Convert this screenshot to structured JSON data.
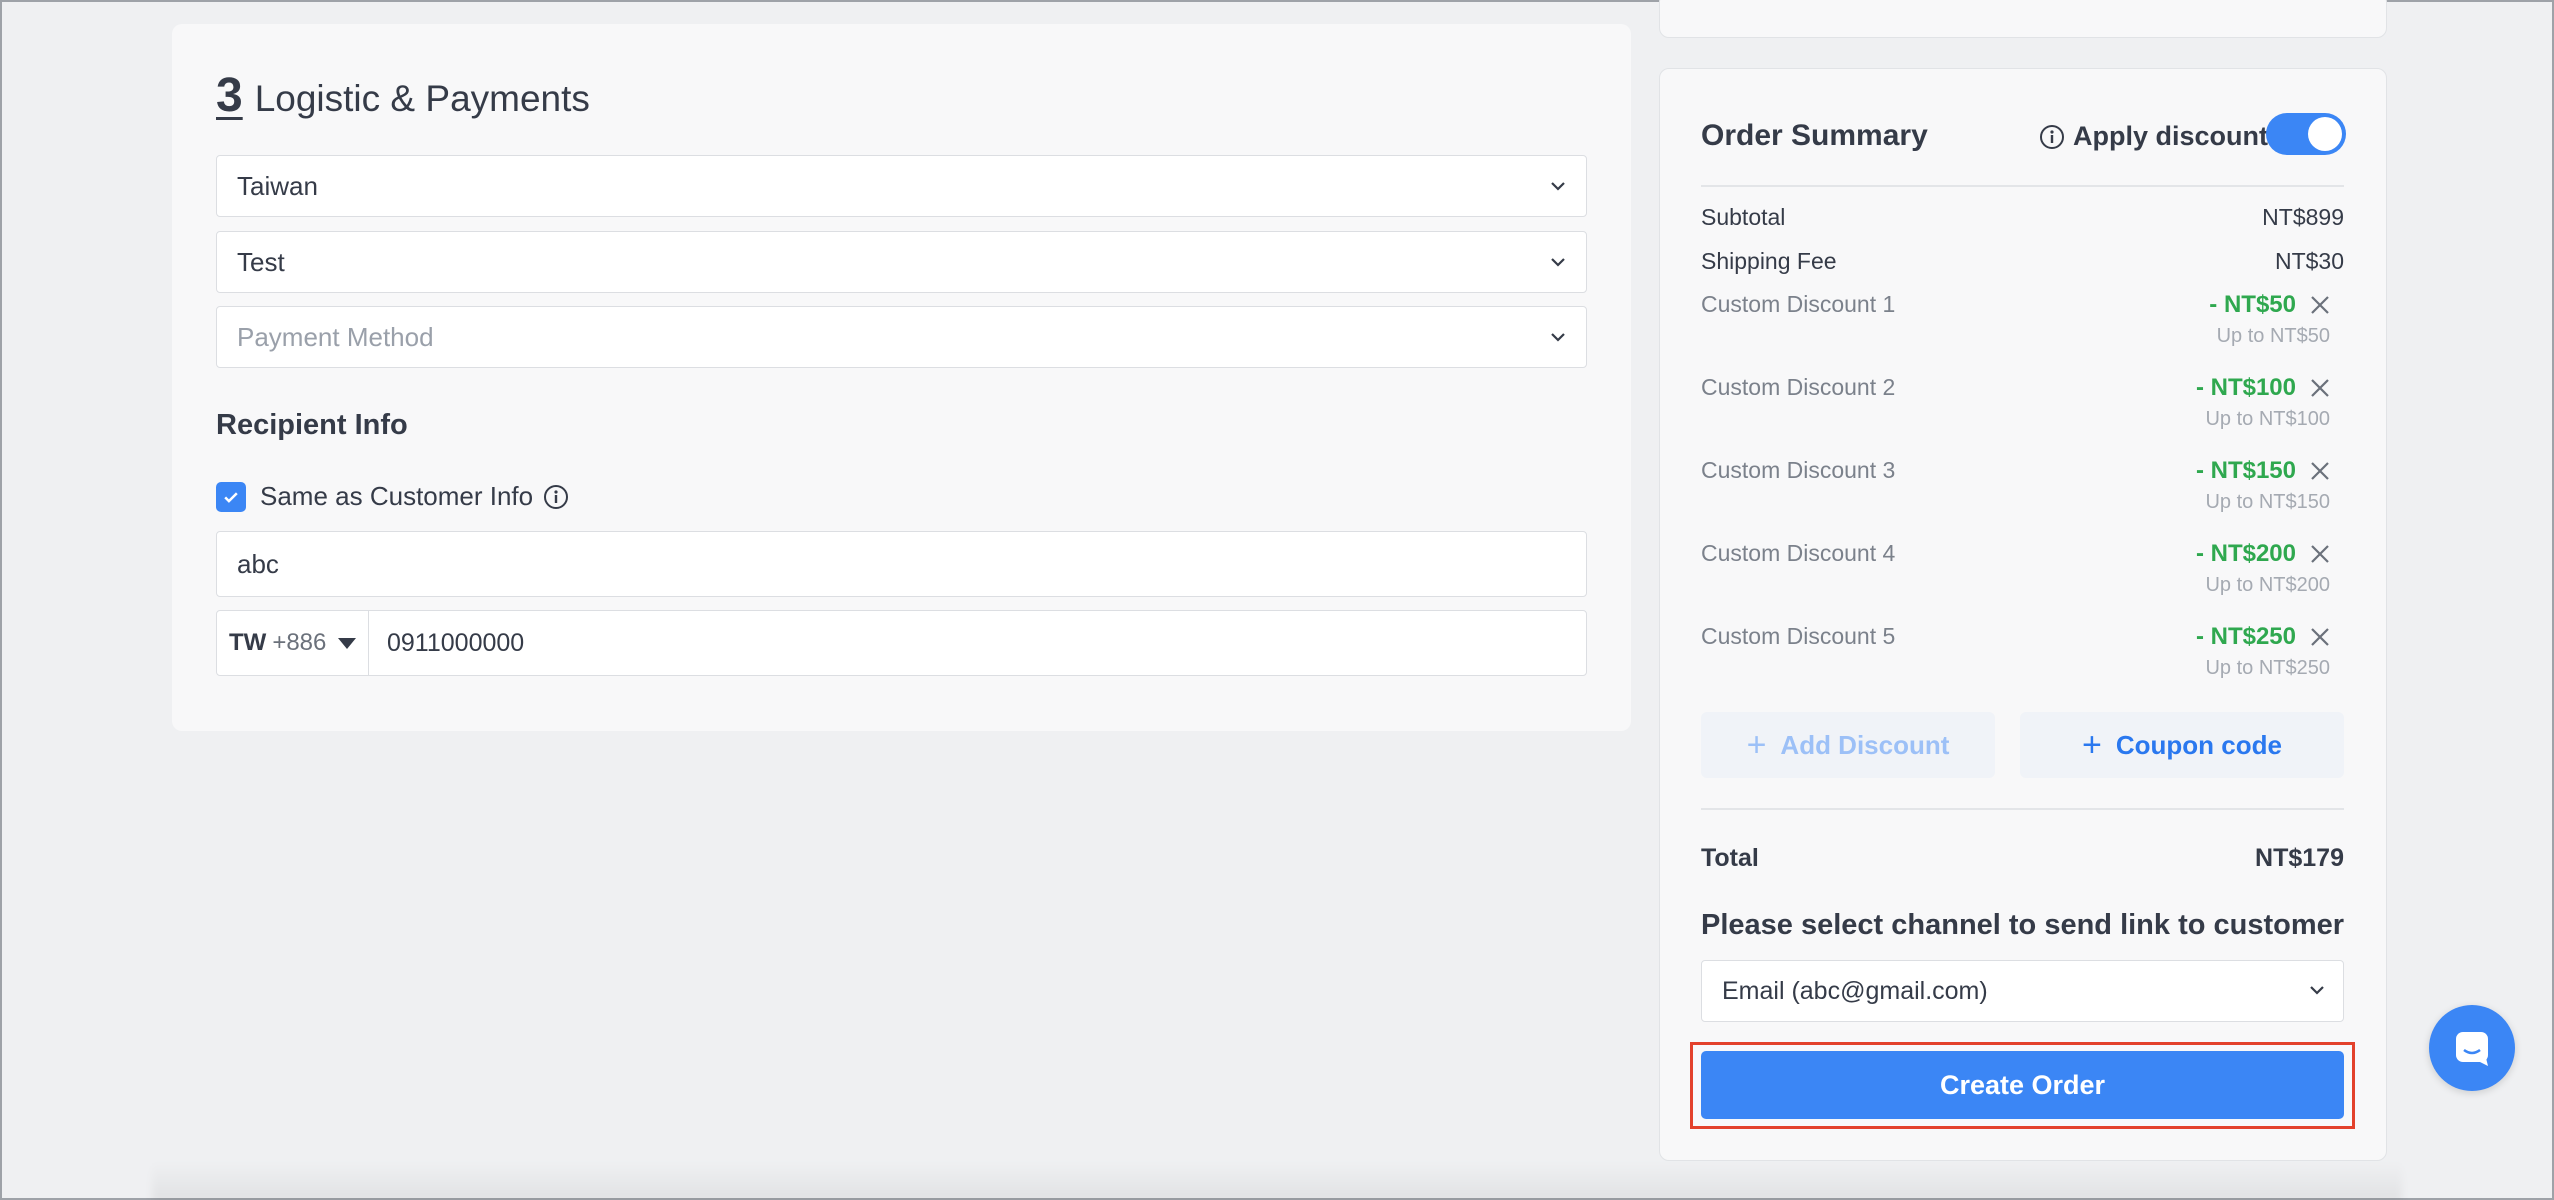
{
  "logistics": {
    "step_number": "3",
    "title": "Logistic & Payments",
    "country_select": "Taiwan",
    "delivery_select": "Test",
    "payment_placeholder": "Payment Method"
  },
  "recipient": {
    "title": "Recipient Info",
    "same_as_customer_label": "Same as Customer Info",
    "same_as_customer_checked": true,
    "name_value": "abc",
    "country_code": "TW",
    "dial_code": "+886",
    "phone_value": "0911000000"
  },
  "summary": {
    "title": "Order Summary",
    "apply_discount_label": "Apply discount",
    "apply_discount_on": true,
    "subtotal_label": "Subtotal",
    "subtotal_value": "NT$899",
    "shipping_label": "Shipping Fee",
    "shipping_value": "NT$30",
    "discounts": [
      {
        "label": "Custom Discount 1",
        "amount": "- NT$50",
        "upto": "Up to  NT$50"
      },
      {
        "label": "Custom Discount 2",
        "amount": "- NT$100",
        "upto": "Up to  NT$100"
      },
      {
        "label": "Custom Discount 3",
        "amount": "- NT$150",
        "upto": "Up to  NT$150"
      },
      {
        "label": "Custom Discount 4",
        "amount": "- NT$200",
        "upto": "Up to  NT$200"
      },
      {
        "label": "Custom Discount 5",
        "amount": "- NT$250",
        "upto": "Up to  NT$250"
      }
    ],
    "add_discount_label": "Add Discount",
    "coupon_label": "Coupon code",
    "total_label": "Total",
    "total_value": "NT$179",
    "channel_title": "Please select channel to send link to customer",
    "channel_value": "Email (abc@gmail.com)",
    "create_button": "Create Order"
  },
  "colors": {
    "accent": "#3b86f5",
    "discount_green": "#2fa84f",
    "highlight_red": "#e3412b"
  },
  "icons": [
    "chevron-down-icon",
    "check-icon",
    "info-icon",
    "close-icon",
    "plus-icon",
    "chat-icon"
  ]
}
